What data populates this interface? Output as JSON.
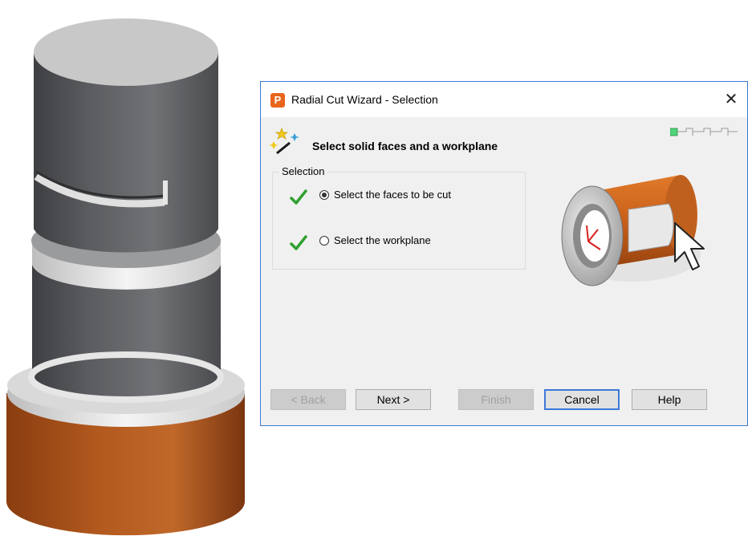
{
  "window": {
    "title": "Radial Cut Wizard - Selection",
    "close_glyph": "✕",
    "app_icon_letter": "P"
  },
  "header": {
    "text": "Select solid faces and a workplane"
  },
  "progress_steps": {
    "total": 4,
    "current": 1
  },
  "selection_group": {
    "label": "Selection",
    "options": [
      {
        "label": "Select the faces to be cut",
        "checked": true,
        "done": true
      },
      {
        "label": "Select the workplane",
        "checked": false,
        "done": true
      }
    ]
  },
  "buttons": {
    "back": "< Back",
    "next": "Next >",
    "finish": "Finish",
    "cancel": "Cancel",
    "help": "Help"
  },
  "colors": {
    "accent": "#3c78d8",
    "copper": "#b8581a",
    "steel": "#6b6d70",
    "check_green": "#2ea02e"
  },
  "icons": [
    "app-p-icon",
    "close-icon",
    "magic-wand-icon",
    "check-icon",
    "mouse-cursor-icon"
  ]
}
